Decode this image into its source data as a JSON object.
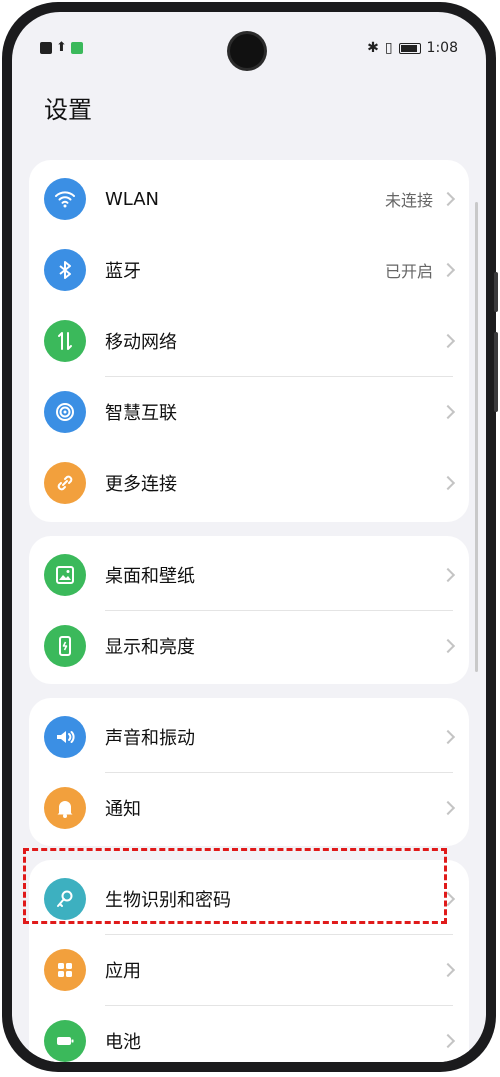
{
  "status_bar": {
    "time": "1:08"
  },
  "page_title": "设置",
  "groups": [
    {
      "items": [
        {
          "label": "WLAN",
          "value": "未连接",
          "icon": "wifi-icon",
          "color": "#3b8fe4"
        },
        {
          "label": "蓝牙",
          "value": "已开启",
          "icon": "bluetooth-icon",
          "color": "#3b8fe4"
        },
        {
          "label": "移动网络",
          "value": "",
          "icon": "mobile-data-icon",
          "color": "#3bb95b"
        },
        {
          "label": "智慧互联",
          "value": "",
          "icon": "connect-icon",
          "color": "#3b8fe4"
        },
        {
          "label": "更多连接",
          "value": "",
          "icon": "link-icon",
          "color": "#f2a03d"
        }
      ]
    },
    {
      "items": [
        {
          "label": "桌面和壁纸",
          "value": "",
          "icon": "wallpaper-icon",
          "color": "#3bb95b"
        },
        {
          "label": "显示和亮度",
          "value": "",
          "icon": "display-icon",
          "color": "#3bb95b"
        }
      ]
    },
    {
      "items": [
        {
          "label": "声音和振动",
          "value": "",
          "icon": "sound-icon",
          "color": "#3b8fe4"
        },
        {
          "label": "通知",
          "value": "",
          "icon": "bell-icon",
          "color": "#f2a03d"
        }
      ]
    },
    {
      "items": [
        {
          "label": "生物识别和密码",
          "value": "",
          "icon": "key-icon",
          "color": "#3db0c0"
        },
        {
          "label": "应用",
          "value": "",
          "icon": "apps-icon",
          "color": "#f2a03d"
        },
        {
          "label": "电池",
          "value": "",
          "icon": "battery-icon",
          "color": "#3bb95b"
        }
      ]
    }
  ]
}
